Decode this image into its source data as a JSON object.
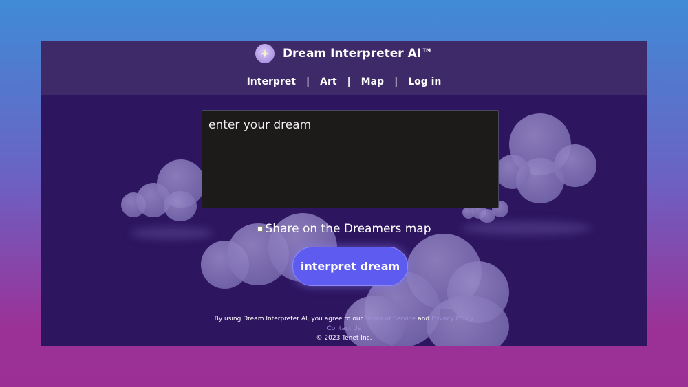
{
  "header": {
    "brand_title": "Dream Interpreter AI™",
    "logo_icon": "sparkle-icon"
  },
  "nav": {
    "items": [
      {
        "label": "Interpret"
      },
      {
        "label": "Art"
      },
      {
        "label": "Map"
      },
      {
        "label": "Log in"
      }
    ],
    "separator": "|"
  },
  "dream_input": {
    "value": "",
    "placeholder": "enter your dream"
  },
  "share": {
    "label": "Share on the Dreamers map",
    "checked": false
  },
  "cta": {
    "label": "interpret dream"
  },
  "footer": {
    "agree_prefix": "By using Dream Interpreter AI, you agree to our",
    "terms_link": "Terms of Service",
    "and_text": "and",
    "privacy_link": "Privacy Policy",
    "contact_link": "Contact Us",
    "copyright": "© 2023 Tenet Inc."
  },
  "colors": {
    "page_bg_top": "#3f8bd6",
    "page_bg_bottom": "#9b2f96",
    "app_bg": "#2d1560",
    "header_bg": "#3e2a68",
    "button": "#5e5cf0",
    "link": "#9b8fd6"
  }
}
